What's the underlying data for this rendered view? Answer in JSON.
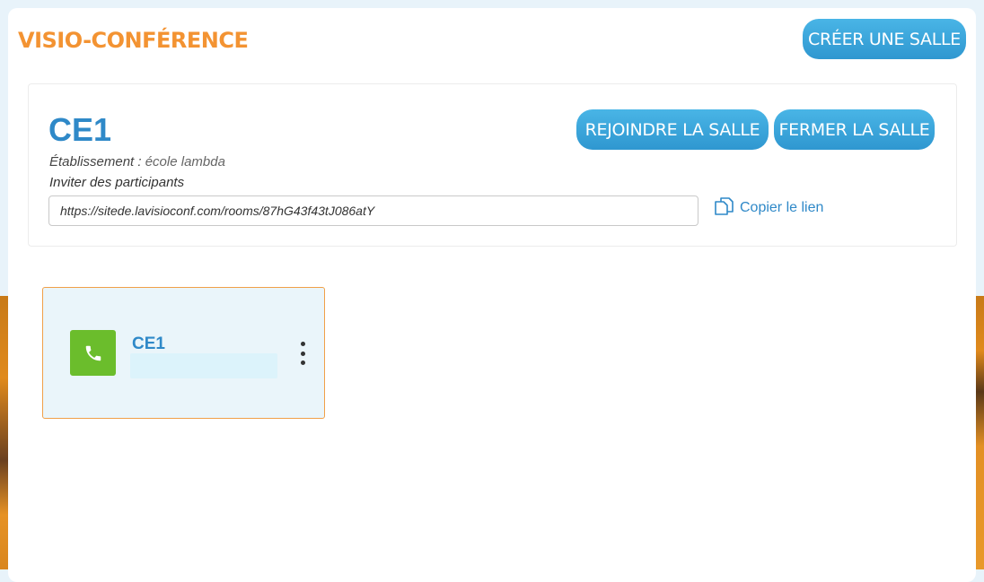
{
  "header": {
    "title": "VISIO-CONFÉRENCE",
    "create_room_label": "CRÉER UNE SALLE"
  },
  "room": {
    "name": "CE1",
    "etablissement_label": "Établissement : ",
    "etablissement_value": "école lambda",
    "invite_label": "Inviter des participants",
    "link_value": "https://sitede.lavisioconf.com/rooms/87hG43f43tJ086atY",
    "copy_link_label": "Copier le lien",
    "join_label": "REJOINDRE LA SALLE",
    "close_label": "FERMER LA SALLE"
  },
  "tiles": [
    {
      "name": "CE1",
      "subtitle": "",
      "icon": "phone-icon"
    }
  ],
  "colors": {
    "accent_orange": "#f39332",
    "accent_blue": "#2f89c8",
    "button_blue": "#3ba6dc",
    "icon_green": "#6bbd2c"
  }
}
